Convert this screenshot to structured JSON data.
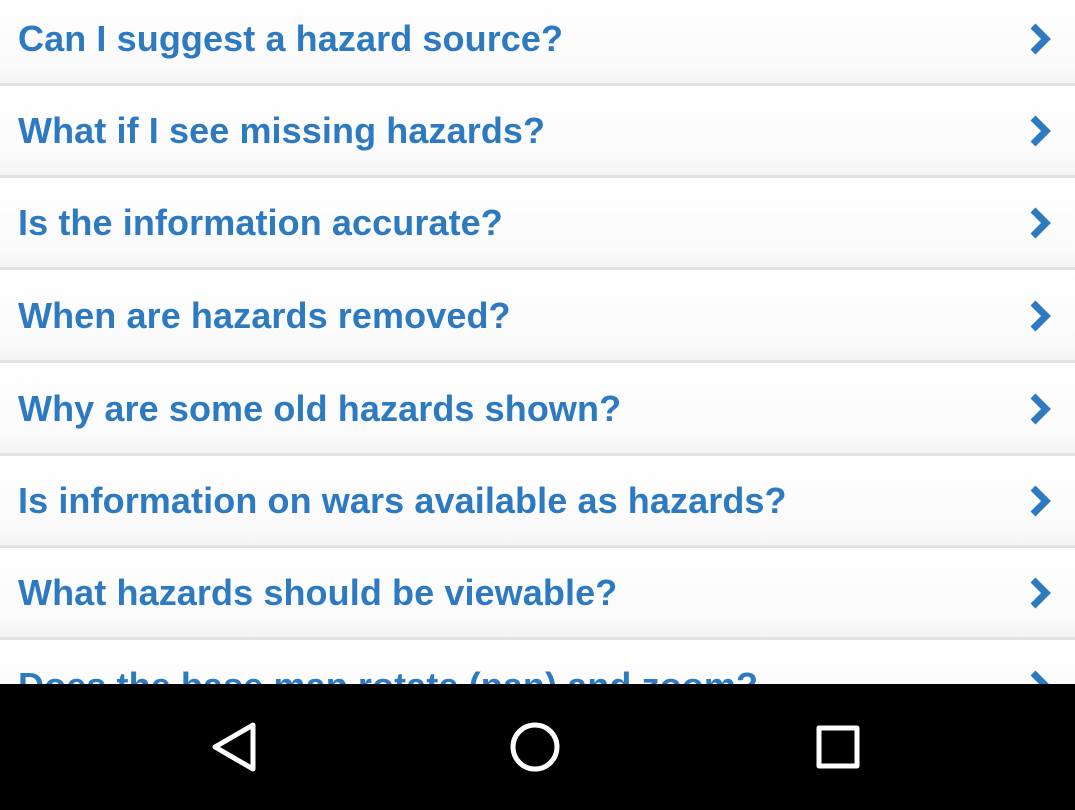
{
  "faq": {
    "items": [
      {
        "label": "Can I suggest a hazard source?"
      },
      {
        "label": "What if I see missing hazards?"
      },
      {
        "label": "Is the information accurate?"
      },
      {
        "label": "When are hazards removed?"
      },
      {
        "label": "Why are some old hazards shown?"
      },
      {
        "label": "Is information on wars available as hazards?"
      },
      {
        "label": "What hazards should be viewable?"
      },
      {
        "label": "Does the base map rotate (pan) and zoom?"
      }
    ],
    "chevron_icon": "chevron-right-icon"
  },
  "navbar": {
    "back_icon": "back-triangle-icon",
    "home_icon": "home-circle-icon",
    "recents_icon": "recents-square-icon"
  },
  "colors": {
    "link_text": "#2e7ac0",
    "chevron": "#2e7ac0",
    "divider": "#e2e2e2",
    "navbar_bg": "#000000",
    "navbar_icon": "#ffffff"
  }
}
